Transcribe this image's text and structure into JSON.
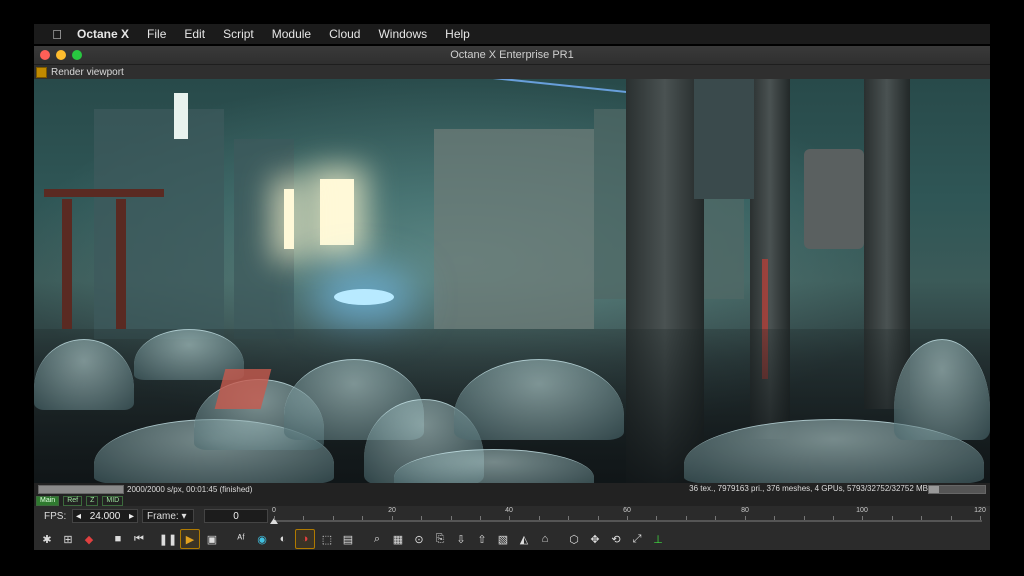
{
  "menubar": {
    "apple_icon": "apple-icon",
    "items": [
      "Octane X",
      "File",
      "Edit",
      "Script",
      "Module",
      "Cloud",
      "Windows",
      "Help"
    ]
  },
  "window": {
    "title": "Octane X Enterprise PR1",
    "traffic_colors": [
      "#ff5f57",
      "#febc2e",
      "#28c840"
    ]
  },
  "viewport": {
    "header_label": "Render viewport"
  },
  "status": {
    "progress_text": "2000/2000 s/px, 00:01:45 (finished)",
    "progress_fraction": 1.0,
    "stats_text": "36 tex., 7979163 pri., 376 meshes, 4 GPUs, 5793/32752/32752 MB",
    "memory_fraction": 0.18
  },
  "passes": [
    "Main",
    "Ref",
    "Z",
    "MID"
  ],
  "timeline": {
    "fps_label": "FPS:",
    "fps_value": "24.000",
    "frame_label": "Frame:",
    "frame_value": "0",
    "ticks": [
      "0",
      "20",
      "40",
      "60",
      "80",
      "100",
      "120"
    ]
  },
  "toolbar": {
    "icons": [
      "camera-reset-icon",
      "region-render-icon",
      "color-cube-icon",
      "stop-icon",
      "rewind-icon",
      "pause-icon",
      "play-icon",
      "viewport-render-icon",
      "af-icon",
      "color-wheel-icon",
      "pick-material-icon",
      "pick-object-icon",
      "region-icon",
      "film-region-icon",
      "zoom-icon",
      "checker-icon",
      "focus-picker-icon",
      "save-image-icon",
      "export-icon",
      "import-icon",
      "layers-icon",
      "clay-icon",
      "lock-icon",
      "cube-icon",
      "move-icon",
      "rotate-icon",
      "scale-icon",
      "axis-gizmo-icon"
    ]
  }
}
